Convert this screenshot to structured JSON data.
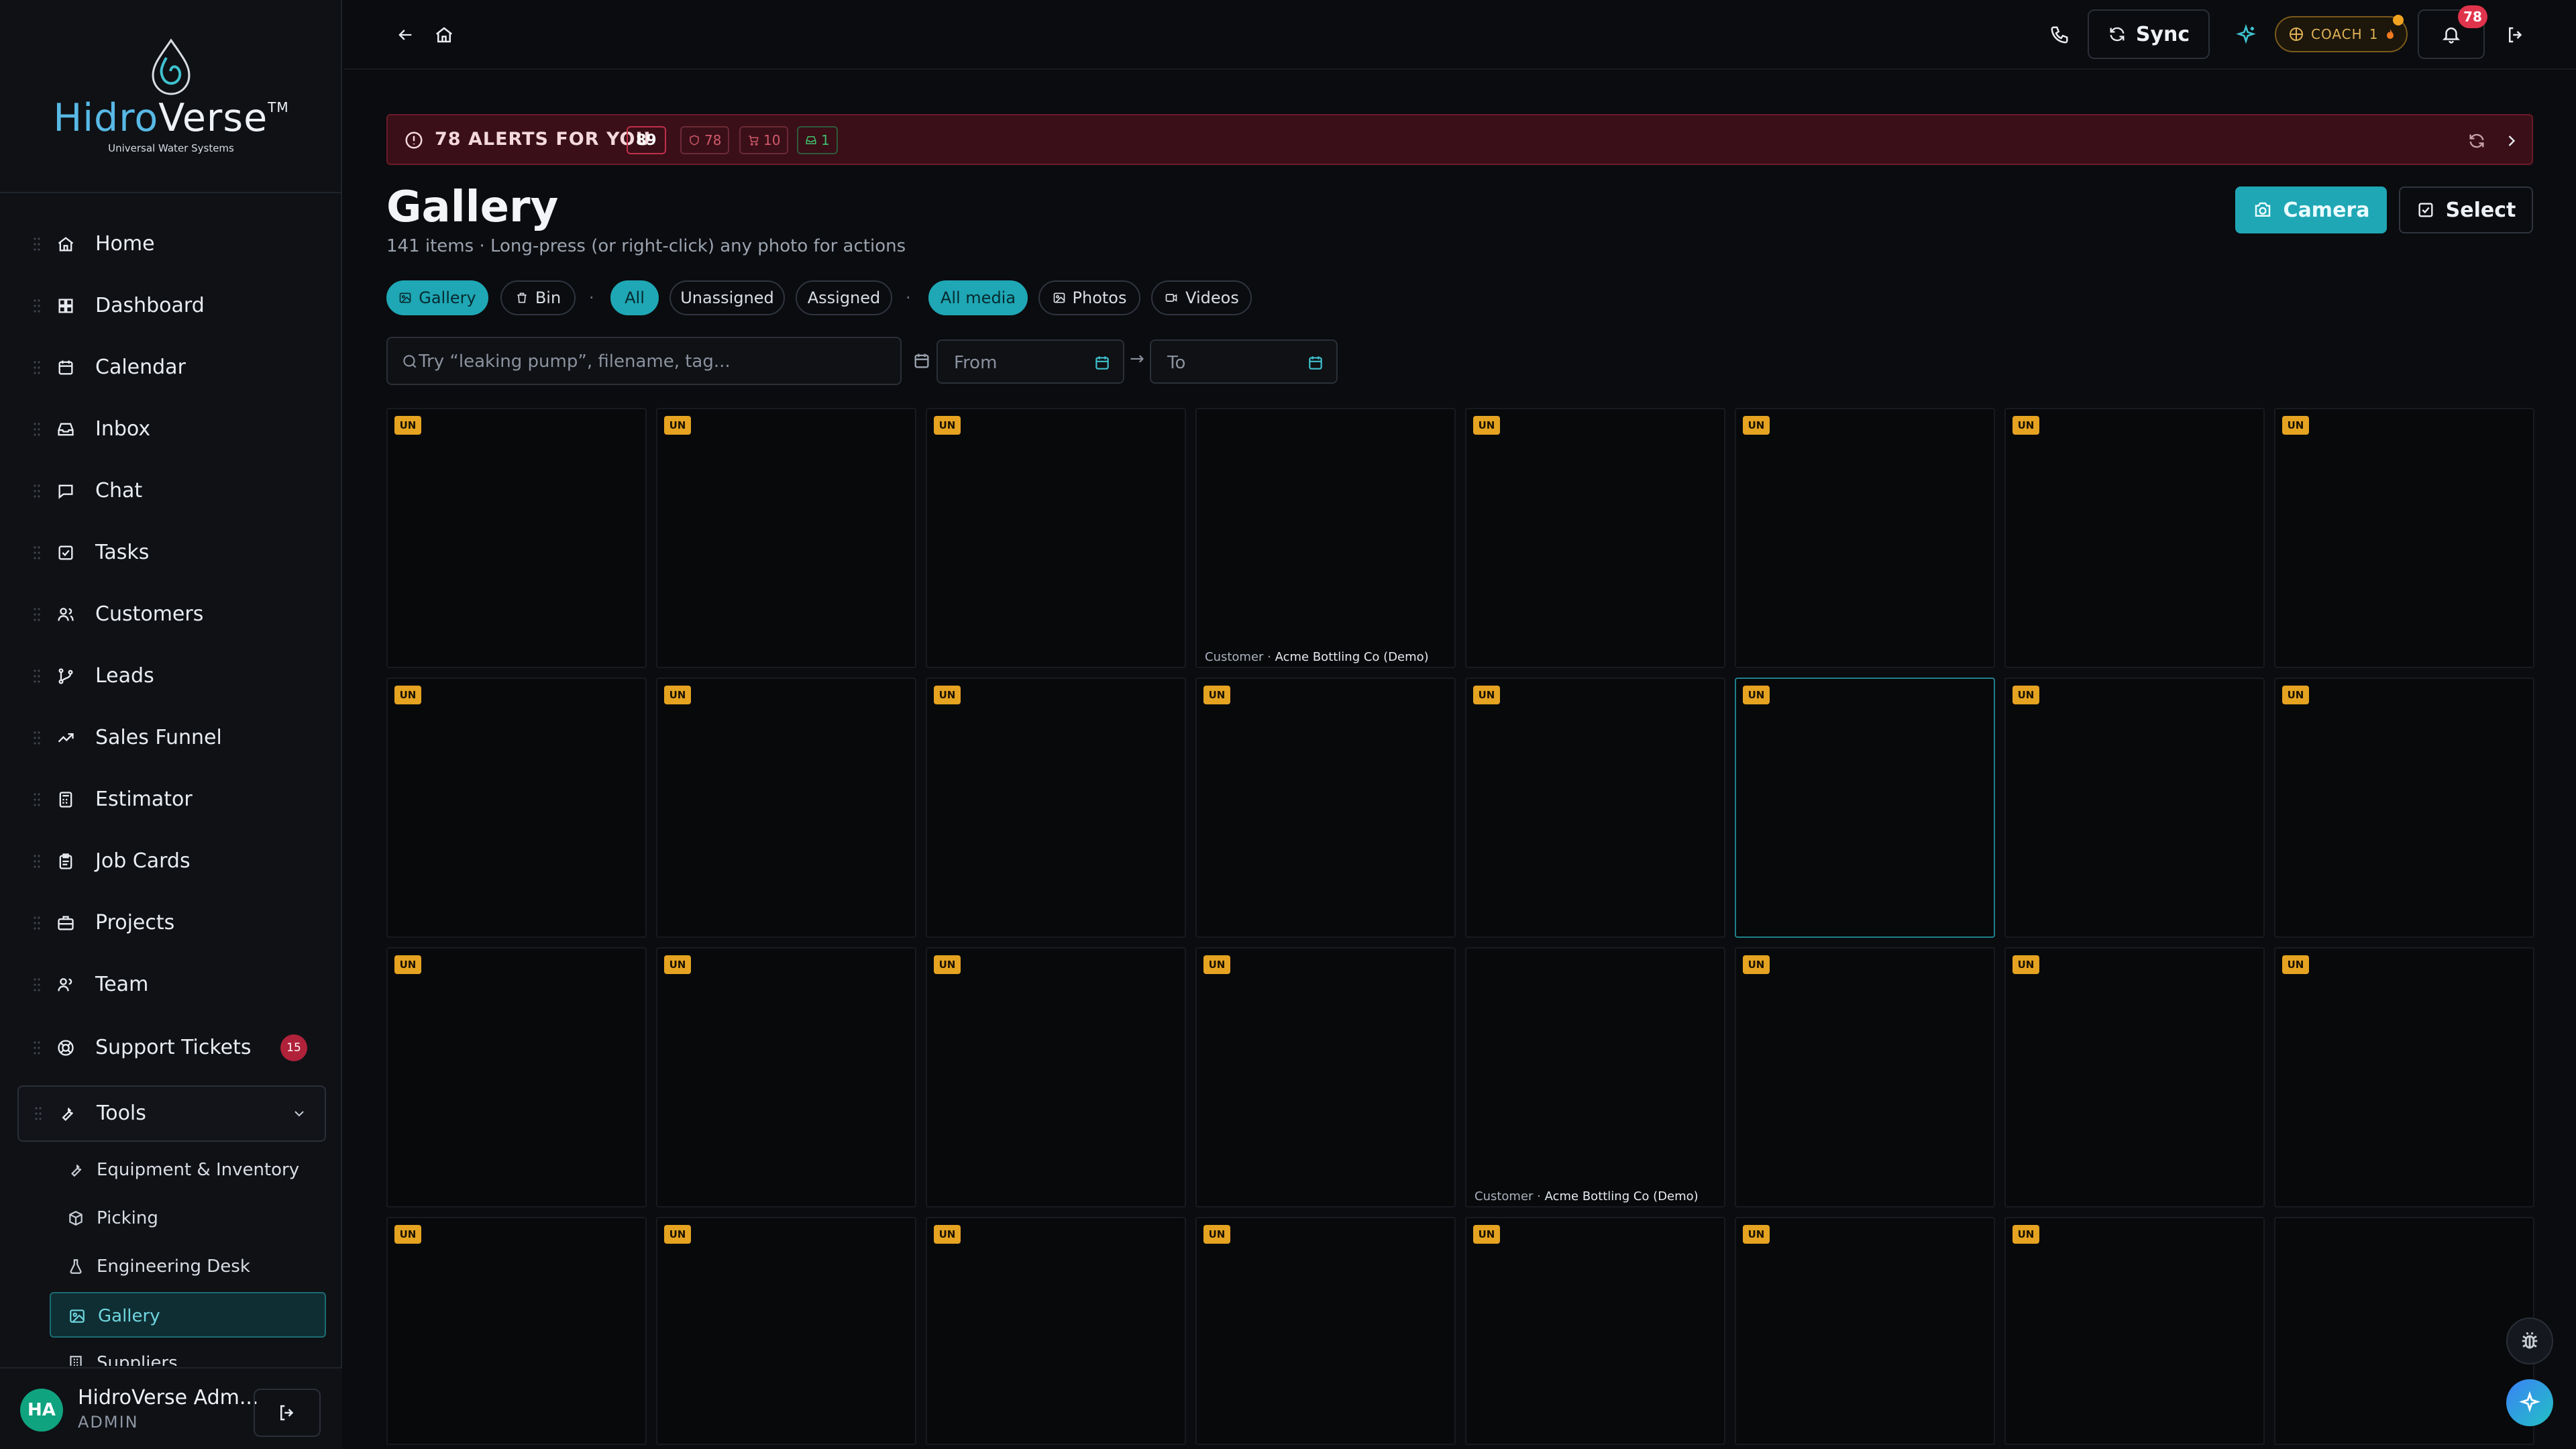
{
  "brand": {
    "name_a": "Hidro",
    "name_b": "Verse",
    "tm": "TM",
    "tagline": "Universal Water Systems"
  },
  "sidebar": {
    "items": [
      {
        "label": "Home",
        "icon": "home-icon"
      },
      {
        "label": "Dashboard",
        "icon": "dashboard-icon"
      },
      {
        "label": "Calendar",
        "icon": "calendar-icon"
      },
      {
        "label": "Inbox",
        "icon": "inbox-icon"
      },
      {
        "label": "Chat",
        "icon": "chat-icon"
      },
      {
        "label": "Tasks",
        "icon": "tasks-icon"
      },
      {
        "label": "Customers",
        "icon": "customers-icon"
      },
      {
        "label": "Leads",
        "icon": "leads-icon"
      },
      {
        "label": "Sales Funnel",
        "icon": "trend-icon"
      },
      {
        "label": "Estimator",
        "icon": "calculator-icon"
      },
      {
        "label": "Job Cards",
        "icon": "clipboard-icon"
      },
      {
        "label": "Projects",
        "icon": "briefcase-icon"
      },
      {
        "label": "Team",
        "icon": "team-icon"
      },
      {
        "label": "Support Tickets",
        "icon": "lifebuoy-icon",
        "badge": "15"
      }
    ],
    "tools": {
      "label": "Tools",
      "children": [
        {
          "label": "Equipment & Inventory",
          "icon": "wrench-icon"
        },
        {
          "label": "Picking",
          "icon": "package-icon"
        },
        {
          "label": "Engineering Desk",
          "icon": "flask-icon"
        },
        {
          "label": "Gallery",
          "icon": "image-icon",
          "active": true
        },
        {
          "label": "Suppliers",
          "icon": "building-icon"
        }
      ]
    },
    "user": {
      "initials": "HA",
      "name": "HidroVerse Adm...",
      "role": "ADMIN"
    }
  },
  "topbar": {
    "sync_label": "Sync",
    "coach_label": "COACH",
    "coach_count": "1",
    "notifications_count": "78"
  },
  "alerts": {
    "title": "78 ALERTS FOR YOU",
    "count": "89",
    "chips": [
      {
        "value": "78",
        "icon": "shield-icon",
        "color": "#d05a6a"
      },
      {
        "value": "10",
        "icon": "cart-icon",
        "color": "#d05a6a"
      },
      {
        "value": "1",
        "icon": "inbox-icon",
        "color": "#3fbf6a"
      }
    ]
  },
  "page": {
    "title": "Gallery",
    "subtitle": "141 items · Long-press (or right-click) any photo for actions",
    "camera_label": "Camera",
    "select_label": "Select"
  },
  "filters": {
    "scope": [
      {
        "label": "Gallery",
        "active": true
      },
      {
        "label": "Bin",
        "active": false
      }
    ],
    "assignment": [
      {
        "label": "All",
        "active": true
      },
      {
        "label": "Unassigned",
        "active": false
      },
      {
        "label": "Assigned",
        "active": false
      }
    ],
    "media": [
      {
        "label": "All media",
        "active": true
      },
      {
        "label": "Photos",
        "active": false
      },
      {
        "label": "Videos",
        "active": false
      }
    ],
    "separator": "·"
  },
  "search": {
    "placeholder": "Try “leaking pump”, filename, tag..."
  },
  "date_range": {
    "from_placeholder": "From",
    "to_placeholder": "To",
    "arrow": "→"
  },
  "gallery": {
    "badge_label": "UN",
    "tiles": [
      {
        "badge": true
      },
      {
        "badge": true
      },
      {
        "badge": true
      },
      {
        "badge": false,
        "caption_prefix": "Customer · ",
        "caption_value": "Acme Bottling Co (Demo)"
      },
      {
        "badge": true
      },
      {
        "badge": true
      },
      {
        "badge": true
      },
      {
        "badge": true
      },
      {
        "badge": true
      },
      {
        "badge": true
      },
      {
        "badge": true
      },
      {
        "badge": true
      },
      {
        "badge": true
      },
      {
        "badge": true,
        "highlight": true
      },
      {
        "badge": true
      },
      {
        "badge": true
      },
      {
        "badge": true
      },
      {
        "badge": true
      },
      {
        "badge": true
      },
      {
        "badge": true
      },
      {
        "badge": false,
        "caption_prefix": "Customer · ",
        "caption_value": "Acme Bottling Co (Demo)"
      },
      {
        "badge": true
      },
      {
        "badge": true
      },
      {
        "badge": true
      },
      {
        "badge": true
      },
      {
        "badge": true
      },
      {
        "badge": true
      },
      {
        "badge": true
      },
      {
        "badge": true
      },
      {
        "badge": true
      },
      {
        "badge": true
      },
      {
        "badge": false
      }
    ]
  }
}
